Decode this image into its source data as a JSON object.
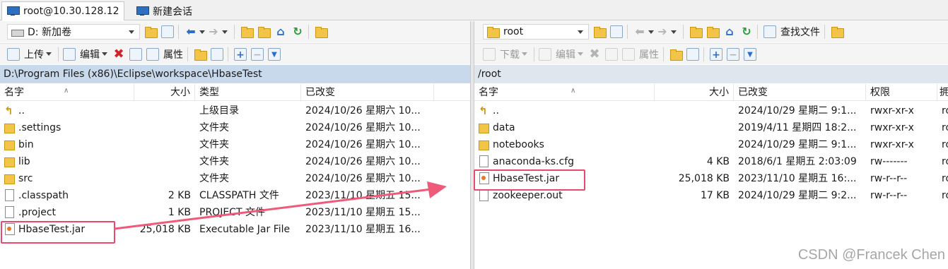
{
  "tabs": [
    {
      "label": "root@10.30.128.12",
      "active": true,
      "icon": "monitor-icon"
    },
    {
      "label": "新建会话",
      "active": false,
      "icon": "monitor-icon"
    }
  ],
  "left": {
    "drive": "D: 新加卷",
    "upload_label": "上传",
    "edit_label": "编辑",
    "properties_label": "属性",
    "path": "D:\\Program Files (x86)\\Eclipse\\workspace\\HbaseTest",
    "columns": {
      "name": "名字",
      "size": "大小",
      "type": "类型",
      "modified": "已改变"
    },
    "rows": [
      {
        "icon": "up",
        "name": "..",
        "size": "",
        "type": "上级目录",
        "modified": "2024/10/26 星期六  10..."
      },
      {
        "icon": "folder",
        "name": ".settings",
        "size": "",
        "type": "文件夹",
        "modified": "2024/10/26 星期六  10..."
      },
      {
        "icon": "folder",
        "name": "bin",
        "size": "",
        "type": "文件夹",
        "modified": "2024/10/26 星期六  10..."
      },
      {
        "icon": "folder",
        "name": "lib",
        "size": "",
        "type": "文件夹",
        "modified": "2024/10/26 星期六  10..."
      },
      {
        "icon": "folder",
        "name": "src",
        "size": "",
        "type": "文件夹",
        "modified": "2024/10/26 星期六  10..."
      },
      {
        "icon": "file",
        "name": ".classpath",
        "size": "2 KB",
        "type": "CLASSPATH 文件",
        "modified": "2023/11/10 星期五  15..."
      },
      {
        "icon": "file",
        "name": ".project",
        "size": "1 KB",
        "type": "PROJECT 文件",
        "modified": "2023/11/10 星期五  15..."
      },
      {
        "icon": "jar",
        "name": "HbaseTest.jar",
        "size": "25,018 KB",
        "type": "Executable Jar File",
        "modified": "2023/11/10 星期五  16..."
      }
    ]
  },
  "right": {
    "folder": "root",
    "find_label": "查找文件",
    "download_label": "下载",
    "edit_label": "编辑",
    "properties_label": "属性",
    "path": "/root",
    "columns": {
      "name": "名字",
      "size": "大小",
      "modified": "已改变",
      "perms": "权限",
      "owner": "拥"
    },
    "rows": [
      {
        "icon": "up",
        "name": "..",
        "size": "",
        "modified": "2024/10/29 星期二  9:1...",
        "perms": "rwxr-xr-x",
        "owner": "ro"
      },
      {
        "icon": "folder",
        "name": "data",
        "size": "",
        "modified": "2019/4/11 星期四  18:2...",
        "perms": "rwxr-xr-x",
        "owner": "ro"
      },
      {
        "icon": "folder",
        "name": "notebooks",
        "size": "",
        "modified": "2024/10/29 星期二  9:1...",
        "perms": "rwxr-xr-x",
        "owner": "ro"
      },
      {
        "icon": "file",
        "name": "anaconda-ks.cfg",
        "size": "4 KB",
        "modified": "2018/6/1 星期五  2:03:09",
        "perms": "rw-------",
        "owner": "ro"
      },
      {
        "icon": "jar",
        "name": "HbaseTest.jar",
        "size": "25,018 KB",
        "modified": "2023/11/10 星期五  16:...",
        "perms": "rw-r--r--",
        "owner": "ro"
      },
      {
        "icon": "file",
        "name": "zookeeper.out",
        "size": "17 KB",
        "modified": "2024/10/29 星期二  9:2...",
        "perms": "rw-r--r--",
        "owner": "ro"
      }
    ]
  },
  "annotation": {
    "color": "#e84a6f"
  },
  "watermark": "CSDN @Francek Chen"
}
